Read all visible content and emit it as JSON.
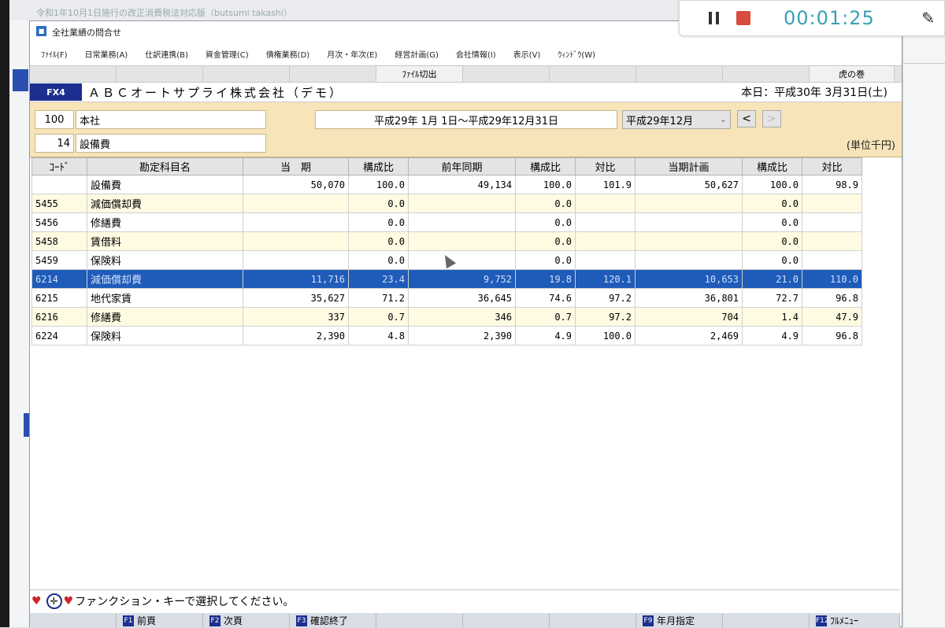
{
  "background": {
    "title": "令和1年10月1日施行の改正消費税法対応版（butsumi takashi）"
  },
  "recorder": {
    "time": "00:01:25",
    "pause_icon": "pause-icon",
    "stop_icon": "stop-icon",
    "pen_icon": "pen-icon"
  },
  "window": {
    "title": "全社業績の問合せ",
    "menu": [
      "ﾌｧｲﾙ(F)",
      "日常業務(A)",
      "仕訳連携(B)",
      "資金管理(C)",
      "債権業務(D)",
      "月次・年次(E)",
      "経営計画(G)",
      "会社情報(I)",
      "表示(V)",
      "ｳｨﾝﾄﾞｳ(W)"
    ],
    "toolbar": {
      "file_output": "ﾌｧｲﾙ切出",
      "tora": "虎の巻"
    },
    "company": {
      "badge": "FX4",
      "name": "ＡＢＣオートサプライ株式会社（デモ）",
      "today": "本日：平成30年 3月31日(土)"
    },
    "criteria": {
      "dept_code": "100",
      "dept_name": "本社",
      "cat_code": "14",
      "cat_name": "設備費",
      "date_range": "平成29年 1月 1日～平成29年12月31日",
      "period": "平成29年12月",
      "prev": "<",
      "next": ">",
      "unit": "(単位千円)"
    },
    "table": {
      "headers": [
        "ｺｰﾄﾞ",
        "勘定科目名",
        "当　期",
        "構成比",
        "前年同期",
        "構成比",
        "対比",
        "当期計画",
        "構成比",
        "対比"
      ],
      "rows": [
        {
          "code": "",
          "name": "設備費",
          "cur": "50,070",
          "r1": "100.0",
          "prev": "49,134",
          "r2": "100.0",
          "cmp1": "101.9",
          "plan": "50,627",
          "r3": "100.0",
          "cmp2": "98.9"
        },
        {
          "code": "5455",
          "name": "減価償却費",
          "cur": "",
          "r1": "0.0",
          "prev": "",
          "r2": "0.0",
          "cmp1": "",
          "plan": "",
          "r3": "0.0",
          "cmp2": ""
        },
        {
          "code": "5456",
          "name": "修繕費",
          "cur": "",
          "r1": "0.0",
          "prev": "",
          "r2": "0.0",
          "cmp1": "",
          "plan": "",
          "r3": "0.0",
          "cmp2": ""
        },
        {
          "code": "5458",
          "name": "賃借料",
          "cur": "",
          "r1": "0.0",
          "prev": "",
          "r2": "0.0",
          "cmp1": "",
          "plan": "",
          "r3": "0.0",
          "cmp2": ""
        },
        {
          "code": "5459",
          "name": "保険料",
          "cur": "",
          "r1": "0.0",
          "prev": "",
          "r2": "0.0",
          "cmp1": "",
          "plan": "",
          "r3": "0.0",
          "cmp2": ""
        },
        {
          "code": "6214",
          "name": "減価償却費",
          "cur": "11,716",
          "r1": "23.4",
          "prev": "9,752",
          "r2": "19.8",
          "cmp1": "120.1",
          "plan": "10,653",
          "r3": "21.0",
          "cmp2": "110.0"
        },
        {
          "code": "6215",
          "name": "地代家賃",
          "cur": "35,627",
          "r1": "71.2",
          "prev": "36,645",
          "r2": "74.6",
          "cmp1": "97.2",
          "plan": "36,801",
          "r3": "72.7",
          "cmp2": "96.8"
        },
        {
          "code": "6216",
          "name": "修繕費",
          "cur": "337",
          "r1": "0.7",
          "prev": "346",
          "r2": "0.7",
          "cmp1": "97.2",
          "plan": "704",
          "r3": "1.4",
          "cmp2": "47.9"
        },
        {
          "code": "6224",
          "name": "保険料",
          "cur": "2,390",
          "r1": "4.8",
          "prev": "2,390",
          "r2": "4.9",
          "cmp1": "100.0",
          "plan": "2,469",
          "r3": "4.9",
          "cmp2": "96.8"
        }
      ],
      "selected_row": 5
    },
    "status": {
      "message": "ファンクション・キーで選択してください。"
    },
    "fkeys": [
      {
        "key": "F1",
        "label": "前頁"
      },
      {
        "key": "F2",
        "label": "次頁"
      },
      {
        "key": "F3",
        "label": "確認終了"
      },
      {
        "key": "F9",
        "label": "年月指定"
      },
      {
        "key": "F12",
        "label": "ﾌﾙﾒﾆｭｰ"
      }
    ],
    "colors": {
      "badge_blue": "#1c2f8f",
      "criteria_bg": "#f7e4b8",
      "selected_row": "#1f5bb8",
      "alt_row": "#fffbe2"
    }
  }
}
